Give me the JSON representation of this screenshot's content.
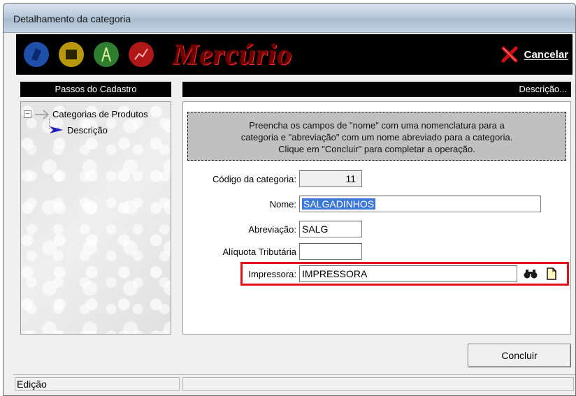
{
  "window": {
    "title": "Detalhamento da categoria"
  },
  "banner": {
    "brand": "Mercúrio",
    "icons": [
      "user-icon",
      "cash-register-icon",
      "radio-tower-icon",
      "chart-icon"
    ],
    "cancel_label": "Cancelar",
    "cancel_icon": "red-x-icon"
  },
  "left": {
    "header": "Passos do Cadastro",
    "tree": {
      "root_label": "Categorias de Produtos",
      "child_label": "Descrição"
    }
  },
  "right": {
    "header": "Descrição...",
    "instructions": [
      "Preencha os campos de \"nome\" com uma nomenclatura para a",
      "categoria e \"abreviação\" com um nome abreviado para a categoria.",
      "Clique em \"Concluir\" para completar a operação."
    ],
    "fields": {
      "codigo_label": "Código da categoria:",
      "codigo_value": "11",
      "nome_label": "Nome:",
      "nome_value": "SALGADINHOS",
      "abreviacao_label": "Abreviação:",
      "abreviacao_value": "SALG",
      "aliquota_label": "Alíquota Tributária",
      "aliquota_value": "",
      "impressora_label": "Impressora:",
      "impressora_value": "IMPRESSORA"
    }
  },
  "actions": {
    "concluir_label": "Concluir"
  },
  "status": {
    "mode": "Edição"
  },
  "colors": {
    "highlight": "#e0101a",
    "brand": "#6e0000",
    "selection": "#3c78d8"
  }
}
